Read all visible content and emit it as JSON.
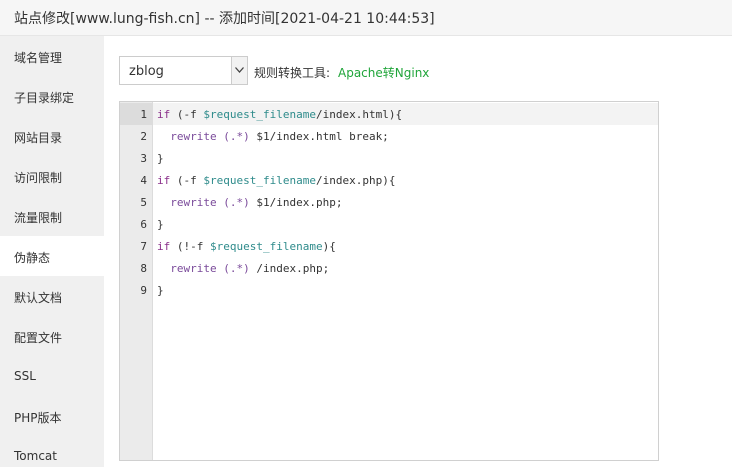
{
  "window": {
    "title": "站点修改[www.lung-fish.cn] -- 添加时间[2021-04-21 10:44:53]"
  },
  "sidebar": {
    "items": [
      {
        "label": "域名管理"
      },
      {
        "label": "子目录绑定"
      },
      {
        "label": "网站目录"
      },
      {
        "label": "访问限制"
      },
      {
        "label": "流量限制"
      },
      {
        "label": "伪静态",
        "active": true
      },
      {
        "label": "默认文档"
      },
      {
        "label": "配置文件"
      },
      {
        "label": "SSL"
      },
      {
        "label": "PHP版本"
      },
      {
        "label": "Tomcat"
      }
    ]
  },
  "rewrite": {
    "template_select": {
      "value": "zblog"
    },
    "tools_label": "规则转换工具:",
    "tools_link": "Apache转Nginx"
  },
  "editor": {
    "lines": [
      {
        "num": "1",
        "parts": [
          {
            "t": "if",
            "c": "kw"
          },
          {
            "t": " (-f ",
            "c": "plain"
          },
          {
            "t": "$request_filename",
            "c": "var"
          },
          {
            "t": "/index.html){",
            "c": "plain"
          }
        ]
      },
      {
        "num": "2",
        "parts": [
          {
            "t": "  rewrite",
            "c": "fn"
          },
          {
            "t": " (.*)",
            "c": "fn"
          },
          {
            "t": " $1/index.html break;",
            "c": "plain"
          }
        ]
      },
      {
        "num": "3",
        "parts": [
          {
            "t": "}",
            "c": "plain"
          }
        ]
      },
      {
        "num": "4",
        "parts": [
          {
            "t": "if",
            "c": "kw"
          },
          {
            "t": " (-f ",
            "c": "plain"
          },
          {
            "t": "$request_filename",
            "c": "var"
          },
          {
            "t": "/index.php){",
            "c": "plain"
          }
        ]
      },
      {
        "num": "5",
        "parts": [
          {
            "t": "  rewrite",
            "c": "fn"
          },
          {
            "t": " (.*)",
            "c": "fn"
          },
          {
            "t": " $1/index.php;",
            "c": "plain"
          }
        ]
      },
      {
        "num": "6",
        "parts": [
          {
            "t": "}",
            "c": "plain"
          }
        ]
      },
      {
        "num": "7",
        "parts": [
          {
            "t": "if",
            "c": "kw"
          },
          {
            "t": " (!-f ",
            "c": "plain"
          },
          {
            "t": "$request_filename",
            "c": "var"
          },
          {
            "t": "){",
            "c": "plain"
          }
        ]
      },
      {
        "num": "8",
        "parts": [
          {
            "t": "  rewrite",
            "c": "fn"
          },
          {
            "t": " (.*)",
            "c": "fn"
          },
          {
            "t": " /index.php;",
            "c": "plain"
          }
        ]
      },
      {
        "num": "9",
        "parts": [
          {
            "t": "}",
            "c": "plain"
          }
        ]
      }
    ]
  },
  "colors": {
    "accent_link": "#20a53a",
    "keyword": "#8a2f8a",
    "variable": "#2e8b8b"
  }
}
